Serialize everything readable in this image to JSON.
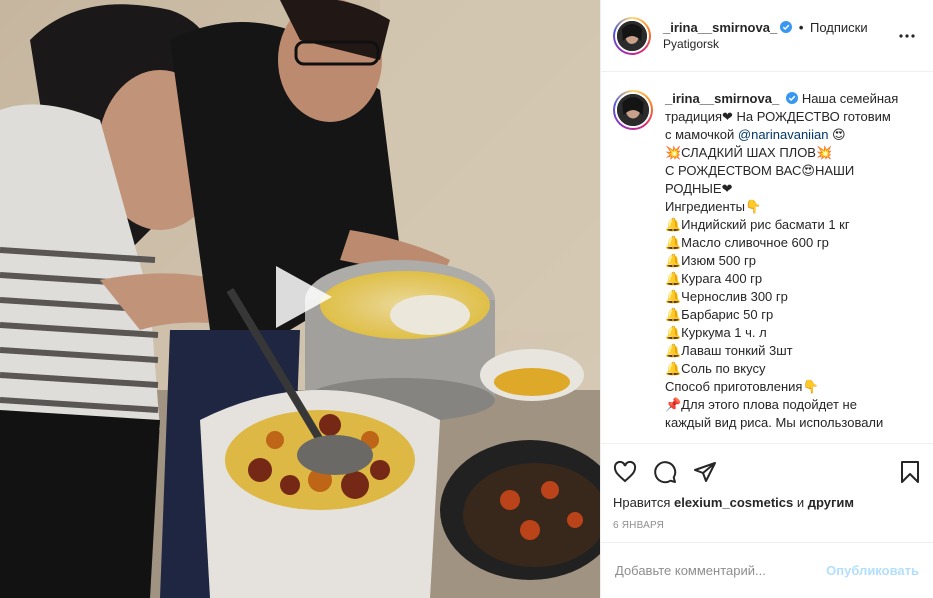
{
  "media": {
    "play_icon": "play-triangle"
  },
  "header": {
    "username": "_irina__smirnova_",
    "verified_icon": "verified-badge",
    "separator": "•",
    "follow_label": "Подписки",
    "location": "Pyatigorsk",
    "more_icon": "ellipsis"
  },
  "caption": {
    "username": "_irina__smirnova_",
    "lines": [
      "Наша семейная",
      "традиция❤ На РОЖДЕСТВО готовим",
      "с мамочкой",
      "💥СЛАДКИЙ ШАХ ПЛОВ💥",
      "С РОЖДЕСТВОМ ВАС😍НАШИ",
      "РОДНЫЕ❤",
      "Ингредиенты👇",
      "🔔Индийский рис басмати 1 кг",
      "🔔Масло сливочное 600 гр",
      "🔔Изюм 500 гр",
      "🔔Курага 400 гр",
      "🔔Чернослив 300 гр",
      "🔔Барбарис 50 гр",
      "🔔Куркума 1 ч. л",
      "🔔Лаваш тонкий 3шт",
      "🔔Соль по вкусу",
      "Способ приготовления👇",
      "📌Для этого плова подойдет не",
      "каждый вид риса. Мы использовали"
    ],
    "mention": "@narinavaniian",
    "mention_suffix": " 😍"
  },
  "actions": {
    "like_icon": "heart-outline",
    "comment_icon": "speech-bubble",
    "share_icon": "paper-plane",
    "save_icon": "bookmark-outline",
    "likes_prefix": "Нравится ",
    "likes_user": "elexium_cosmetics",
    "likes_middle": " и ",
    "likes_others": "другим",
    "date": "6 января"
  },
  "comment": {
    "placeholder": "Добавьте комментарий...",
    "publish_label": "Опубликовать"
  },
  "colors": {
    "accent_disabled": "#b2dffc",
    "link": "#00376b",
    "text": "#262626",
    "muted": "#8e8e8e",
    "verified": "#3897f0"
  }
}
